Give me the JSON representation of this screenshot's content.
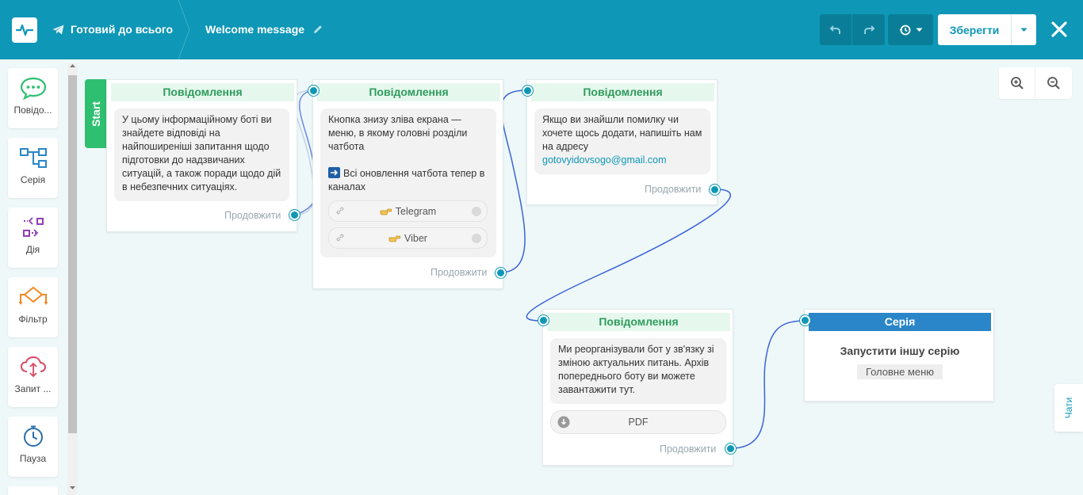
{
  "header": {
    "bot_name": "Готовий до всього",
    "flow_name": "Welcome message",
    "save_label": "Зберегти",
    "icons": [
      "logo-icon",
      "telegram-icon",
      "pencil-icon",
      "undo-icon",
      "redo-icon",
      "history-icon",
      "caret-down-icon",
      "close-icon"
    ]
  },
  "sidebar": {
    "items": [
      {
        "label": "Повідо...",
        "icon": "message-icon"
      },
      {
        "label": "Серія",
        "icon": "series-icon"
      },
      {
        "label": "Дія",
        "icon": "action-icon"
      },
      {
        "label": "Фільтр",
        "icon": "filter-icon"
      },
      {
        "label": "Запит ...",
        "icon": "request-icon"
      },
      {
        "label": "Пауза",
        "icon": "pause-icon"
      }
    ]
  },
  "canvas": {
    "start_label": "Start",
    "continue_label": "Продовжити",
    "cards": [
      {
        "title": "Повідомлення",
        "text": "У цьому інформаційному боті ви знайдете відповіді на найпоширеніші запитання щодо підготовки до надзвичаних ситуацій, а також поради щодо дій в небезпечних ситуаціях."
      },
      {
        "title": "Повідомлення",
        "text_line1": "Кнопка знизу зліва екрана — меню, в якому головні розділи чатбота",
        "text_line2": "Всі оновлення чатбота тепер в каналах",
        "buttons": [
          "Telegram",
          "Viber"
        ]
      },
      {
        "title": "Повідомлення",
        "text": "Якщо ви знайшли помилку чи хочете щось додати, напишіть нам на адресу",
        "email": "gotovyidovsogo@gmail.com"
      },
      {
        "title": "Повідомлення",
        "text": "Ми реорганізували бот у зв'язку зі зміною актуальних питань. Архів попереднього боту ви можете завантажити тут.",
        "button": "PDF"
      }
    ],
    "series_card": {
      "title": "Серія",
      "text": "Запустити іншу серію",
      "tag": "Головне меню"
    }
  },
  "zoom": {
    "icons": [
      "zoom-in-icon",
      "zoom-out-icon"
    ]
  },
  "chats_tab_label": "Чати",
  "colors": {
    "header": "#0e97b6",
    "accent_green": "#2fbf71",
    "card_header_bg": "#e6f8ee",
    "link": "#0e97b6",
    "series_header": "#2a86c8",
    "canvas_bg": "#eef8f9"
  }
}
